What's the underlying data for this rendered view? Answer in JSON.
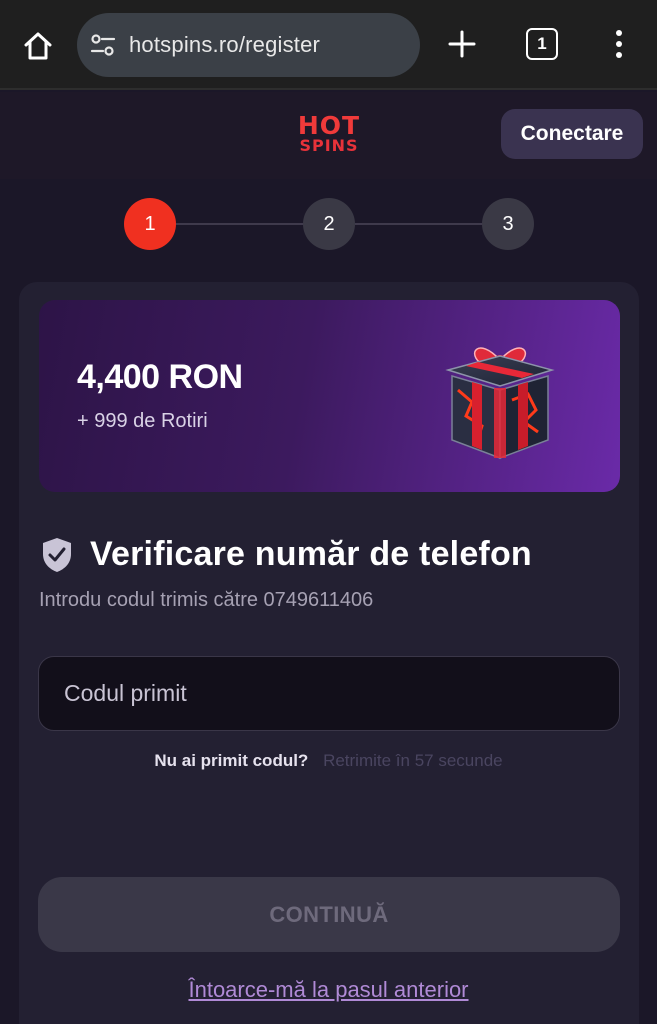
{
  "browser": {
    "url": "hotspins.ro/register",
    "tab_count": "1"
  },
  "header": {
    "logo_top": "HOT",
    "logo_bottom": "SPINS",
    "connect_label": "Conectare"
  },
  "stepper": {
    "steps": [
      "1",
      "2",
      "3"
    ],
    "active_step": 1
  },
  "promo": {
    "amount": "4,400 RON",
    "subtitle": "+ 999 de Rotiri"
  },
  "verification": {
    "title": "Verificare număr de telefon",
    "subtitle": "Introdu codul trimis către 0749611406",
    "code_placeholder": "Codul primit",
    "resend_question": "Nu ai primit codul?",
    "resend_timer": "Retrimite în 57 secunde"
  },
  "actions": {
    "continue_label": "CONTINUĂ",
    "back_label": "Întoarce-mă la pasul anterior"
  },
  "colors": {
    "accent_red": "#f03020",
    "page_bg": "#1b1728",
    "promo_purple": "#6a2aa8",
    "link_purple": "#b08ad6"
  }
}
